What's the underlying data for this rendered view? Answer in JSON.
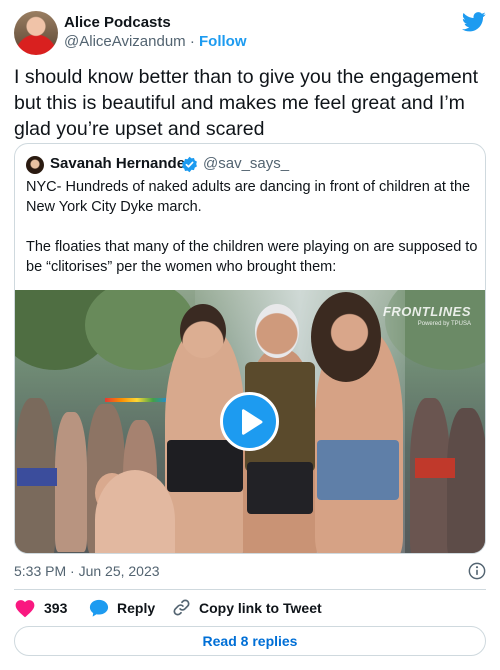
{
  "author": {
    "name": "Alice Podcasts",
    "handle": "@AliceAvizandum",
    "separator": "·",
    "follow_label": "Follow"
  },
  "tweet": {
    "text": "I should know better than to give you the engagement but this is beautiful and makes me feel great and I’m glad you’re upset and scared",
    "timestamp": "5:33 PM · Jun 25, 2023"
  },
  "quoted": {
    "name": "Savanah Hernandez",
    "handle": "@sav_says_",
    "text_p1": "NYC- Hundreds of naked adults are dancing in front of children at the New York City Dyke march.",
    "text_p2": "The floaties that many of the children were playing on are supposed to be “clitorises” per the women who brought them:",
    "media": {
      "watermark_title": "FRONTLINES",
      "watermark_sub": "Powered by TPUSA"
    }
  },
  "actions": {
    "likes_count": "393",
    "reply_label": "Reply",
    "copy_link_label": "Copy link to Tweet"
  },
  "read_replies_label": "Read 8 replies",
  "colors": {
    "accent": "#1d9bf0",
    "like": "#f91880",
    "text": "#0f1419",
    "muted": "#536471",
    "border": "#cfd9de"
  },
  "icons": [
    "twitter-bird-icon",
    "verified-badge-icon",
    "play-icon",
    "info-icon",
    "heart-icon",
    "reply-bubble-icon",
    "link-icon"
  ]
}
